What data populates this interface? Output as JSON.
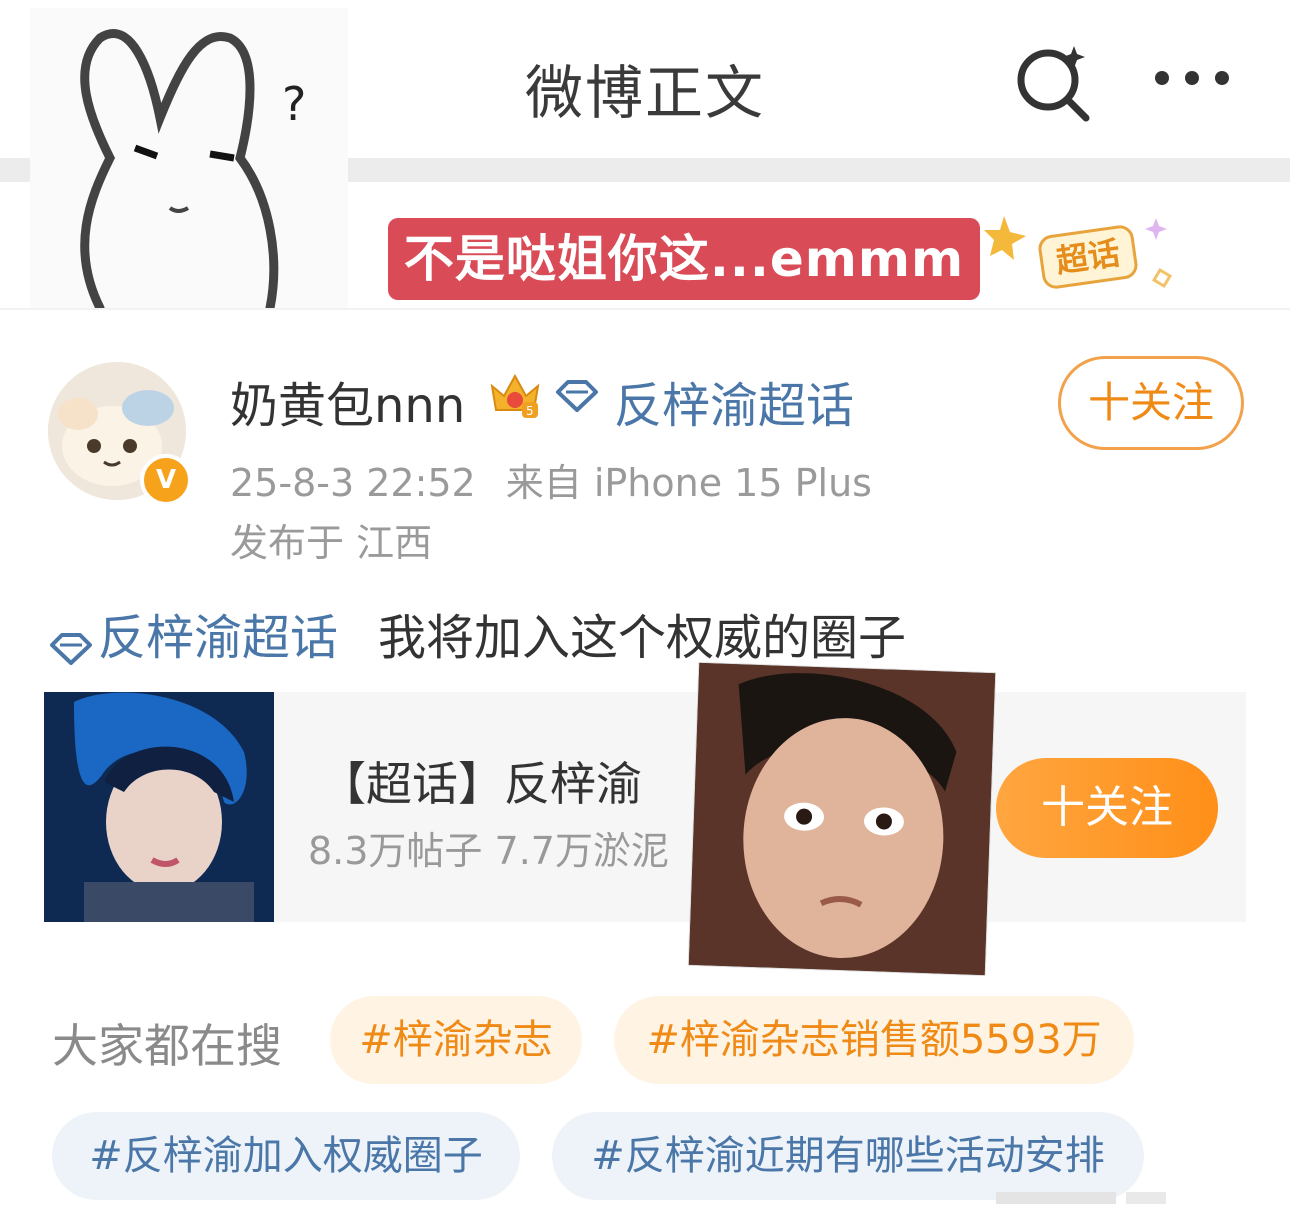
{
  "header": {
    "title": "微博正文",
    "search_icon": "search-sparkle-icon",
    "more_icon": "more-dots-icon"
  },
  "meme_overlay": {
    "bunny_mark": "?",
    "caption": "不是哒姐你这...emmm",
    "sticker_label": "超话",
    "caption_color": "#d94b57"
  },
  "author": {
    "name": "奶黄包nnn",
    "crown_icon": "crown-level-5-icon",
    "topic_icon": "diamond-icon",
    "topic": "反梓渝超话",
    "verified_mark": "V",
    "follow_label": "十关注",
    "time": "25-8-3 22:52",
    "source": "来自 iPhone 15 Plus",
    "location": "发布于 江西"
  },
  "post": {
    "topic_icon": "diamond-icon",
    "topic": "反梓渝超话",
    "text": "我将加入这个权威的圈子"
  },
  "card": {
    "title": "【超话】反梓渝",
    "stats": "8.3万帖子 7.7万淤泥",
    "follow_label": "十关注"
  },
  "trending": {
    "label": "大家都在搜",
    "tags": [
      "#梓渝杂志",
      "#梓渝杂志销售额5593万",
      "#反梓渝加入权威圈子",
      "#反梓渝近期有哪些活动安排"
    ]
  },
  "colors": {
    "accent_orange": "#f08a16",
    "link_blue": "#4a77a8",
    "muted_gray": "#9a9a9a"
  }
}
